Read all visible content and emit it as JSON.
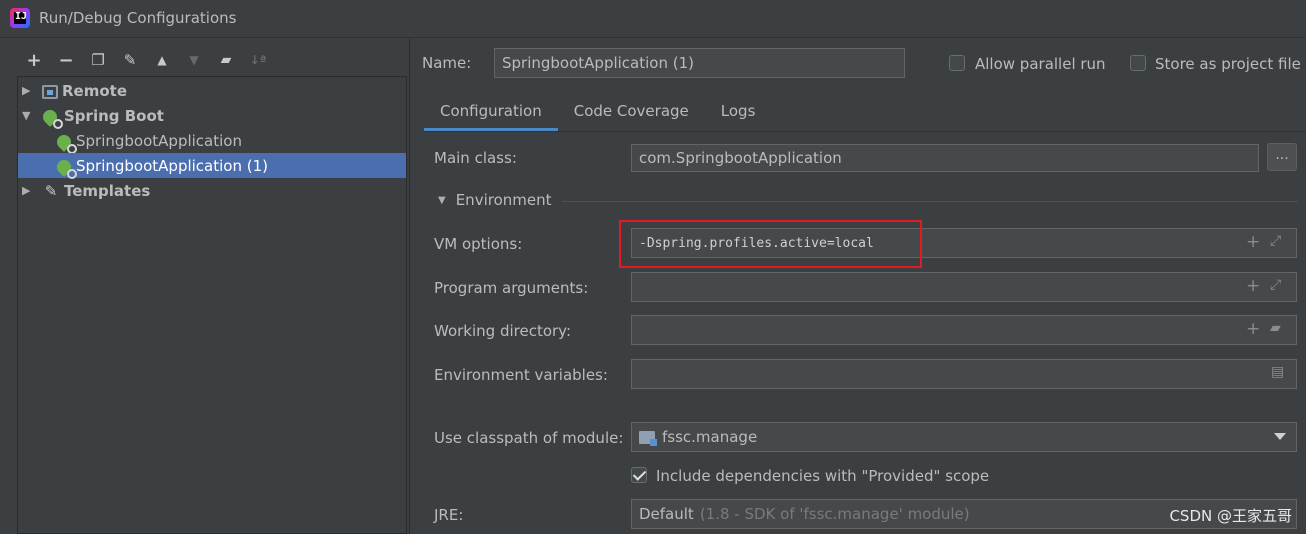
{
  "window": {
    "title": "Run/Debug Configurations"
  },
  "toolbar": {
    "buttons": [
      {
        "name": "add-icon",
        "glyph": "+"
      },
      {
        "name": "remove-icon",
        "glyph": "−"
      },
      {
        "name": "copy-icon",
        "glyph": "⧉"
      },
      {
        "name": "wrench-icon",
        "glyph": "🔧"
      },
      {
        "name": "move-up-icon",
        "glyph": "▲"
      },
      {
        "name": "move-down-icon",
        "glyph": "▼"
      },
      {
        "name": "new-folder-icon",
        "glyph": "📁"
      },
      {
        "name": "sort-icon",
        "glyph": "↓a"
      }
    ]
  },
  "tree": {
    "items": [
      {
        "label": "Remote"
      },
      {
        "label": "Spring Boot"
      },
      {
        "label": "SpringbootApplication"
      },
      {
        "label": "SpringbootApplication (1)"
      },
      {
        "label": "Templates"
      }
    ]
  },
  "header": {
    "name_label": "Name:",
    "name_value": "SpringbootApplication (1)",
    "allow_parallel_label": "Allow parallel run",
    "store_as_project_label": "Store as project file"
  },
  "tabs": [
    {
      "label": "Configuration",
      "active": true
    },
    {
      "label": "Code Coverage"
    },
    {
      "label": "Logs"
    }
  ],
  "config": {
    "main_class_label": "Main class:",
    "main_class_value": "com.SpringbootApplication",
    "browse_label": "...",
    "environment_label": "Environment",
    "vm_options_label": "VM options:",
    "vm_options_value": "-Dspring.profiles.active=local",
    "program_args_label": "Program arguments:",
    "working_dir_label": "Working directory:",
    "env_vars_label": "Environment variables:",
    "classpath_label": "Use classpath of module:",
    "classpath_value": "fssc.manage",
    "include_deps_label": "Include dependencies with \"Provided\" scope",
    "jre_label": "JRE:",
    "jre_value": "Default",
    "jre_detail": "(1.8 - SDK of 'fssc.manage' module)"
  },
  "watermark": "CSDN @王家五哥",
  "colors": {
    "background": "#3c3f41",
    "selection": "#4b6eaf",
    "tab_underline": "#4a88c7",
    "highlight_box": "#e21b23"
  }
}
